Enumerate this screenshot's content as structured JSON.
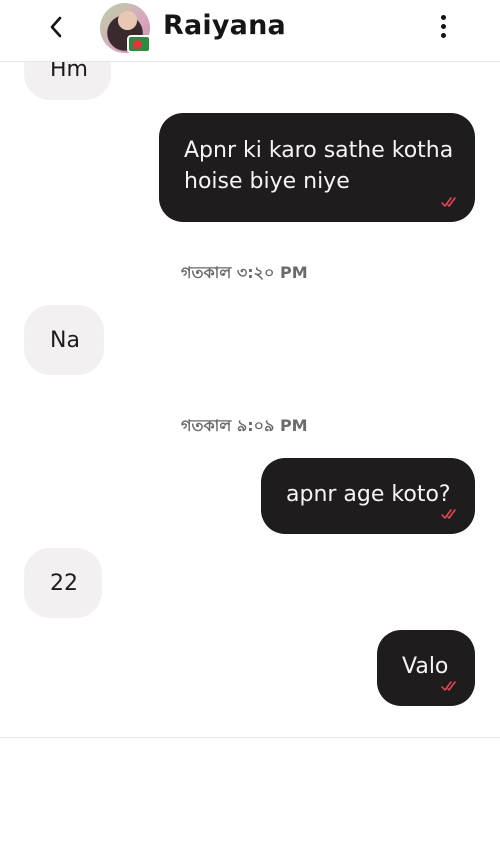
{
  "header": {
    "contact_name": "Raiyana",
    "icons": {
      "back": "chevron-left-icon",
      "avatar": "profile-photo",
      "flag": "bangladesh-flag-icon",
      "more": "more-vertical-icon"
    }
  },
  "colors": {
    "incoming_bubble": "#f2f0f1",
    "outgoing_bubble": "#1f1c1d",
    "read_ticks": "#e8485a",
    "timestamp": "#6b6b6b"
  },
  "messages": [
    {
      "direction": "in",
      "text": "Hm"
    },
    {
      "direction": "out",
      "text": "Apnr ki karo sathe kotha hoise biye niye",
      "status": "read"
    },
    {
      "direction": "in",
      "text": "Na"
    },
    {
      "direction": "out",
      "text": "apnr age koto?",
      "status": "read"
    },
    {
      "direction": "in",
      "text": "22"
    },
    {
      "direction": "out",
      "text": "Valo",
      "status": "read"
    }
  ],
  "timestamps": [
    "গতকাল ৩:২০ PM",
    "গতকাল ৯:০৯ PM"
  ]
}
